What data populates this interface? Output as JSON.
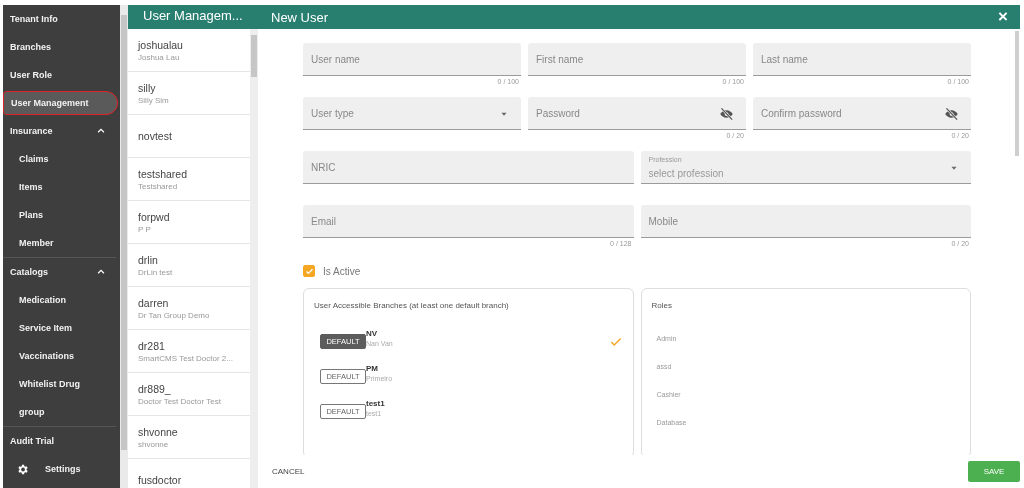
{
  "sidebar": {
    "items": [
      {
        "label": "Tenant Info",
        "selected": false
      },
      {
        "label": "Branches",
        "selected": false
      },
      {
        "label": "User Role",
        "selected": false
      },
      {
        "label": "User Management",
        "selected": true
      },
      {
        "label": "Insurance",
        "selected": false,
        "expanded": true,
        "children": [
          {
            "label": "Claims",
            "selected": false
          },
          {
            "label": "Items",
            "selected": false
          },
          {
            "label": "Plans",
            "selected": false
          },
          {
            "label": "Member",
            "selected": false
          }
        ]
      },
      {
        "label": "Catalogs",
        "selected": false,
        "expanded": true,
        "children": [
          {
            "label": "Medication",
            "selected": false
          },
          {
            "label": "Service Item",
            "selected": false
          },
          {
            "label": "Vaccinations",
            "selected": false
          },
          {
            "label": "Whitelist Drug",
            "selected": false
          },
          {
            "label": "group",
            "selected": false
          }
        ]
      },
      {
        "label": "Audit Trial",
        "selected": false
      }
    ],
    "settings": {
      "label": "Settings"
    }
  },
  "user_list": {
    "title": "User Managem...",
    "users": [
      {
        "username": "joshualau",
        "full_name": "Joshua Lau"
      },
      {
        "username": "silly",
        "full_name": "Silly Sim"
      },
      {
        "username": "novtest"
      },
      {
        "username": "testshared",
        "full_name": "Testshared"
      },
      {
        "username": "forpwd",
        "full_name": "P P"
      },
      {
        "username": "drlin",
        "full_name": "DrLin test"
      },
      {
        "username": "darren",
        "full_name": "Dr Tan Group Demo"
      },
      {
        "username": "dr281",
        "full_name": "SmartCMS Test Doctor 2..."
      },
      {
        "username": "dr889_",
        "full_name": "Doctor Test Doctor Test"
      },
      {
        "username": "shvonne",
        "full_name": "shvonne"
      },
      {
        "username": "fusdoctor"
      }
    ]
  },
  "dialog": {
    "title": "New User",
    "close": "×",
    "form_rows": [
      [
        {
          "kind": "text",
          "placeholder": "User name",
          "counter": "0 / 100"
        },
        {
          "kind": "text",
          "placeholder": "First name",
          "counter": "0 / 100"
        },
        {
          "kind": "text",
          "placeholder": "Last name",
          "counter": "0 / 100"
        }
      ],
      [
        {
          "kind": "select",
          "placeholder": "User type"
        },
        {
          "kind": "password",
          "placeholder": "Password",
          "counter": "0 / 20"
        },
        {
          "kind": "password",
          "placeholder": "Confirm password",
          "counter": "0 / 20"
        }
      ],
      [
        {
          "kind": "text",
          "placeholder": "NRIC"
        },
        {
          "kind": "select",
          "label": "Profession",
          "placeholder": "select profession"
        }
      ],
      [
        {
          "kind": "text",
          "placeholder": "Email",
          "counter": "0 / 128"
        },
        {
          "kind": "text",
          "placeholder": "Mobile",
          "counter": "0 / 20"
        }
      ]
    ],
    "is_active": {
      "label": "Is Active",
      "checked": true
    },
    "branches": {
      "title": "User Accessible Branches (at least one default branch)",
      "items": [
        {
          "default_label": "DEFAULT",
          "is_default": true,
          "code": "NV",
          "name": "Nan Van",
          "selected": true
        },
        {
          "default_label": "DEFAULT",
          "is_default": false,
          "code": "PM",
          "name": "Primeiro",
          "selected": false
        },
        {
          "default_label": "DEFAULT",
          "is_default": false,
          "code": "test1",
          "name": "test1",
          "selected": false
        }
      ]
    },
    "roles": {
      "title": "Roles",
      "items": [
        "Admin",
        "assd",
        "Cashier",
        "Database"
      ]
    },
    "cancel": "CANCEL",
    "save": "SAVE"
  }
}
